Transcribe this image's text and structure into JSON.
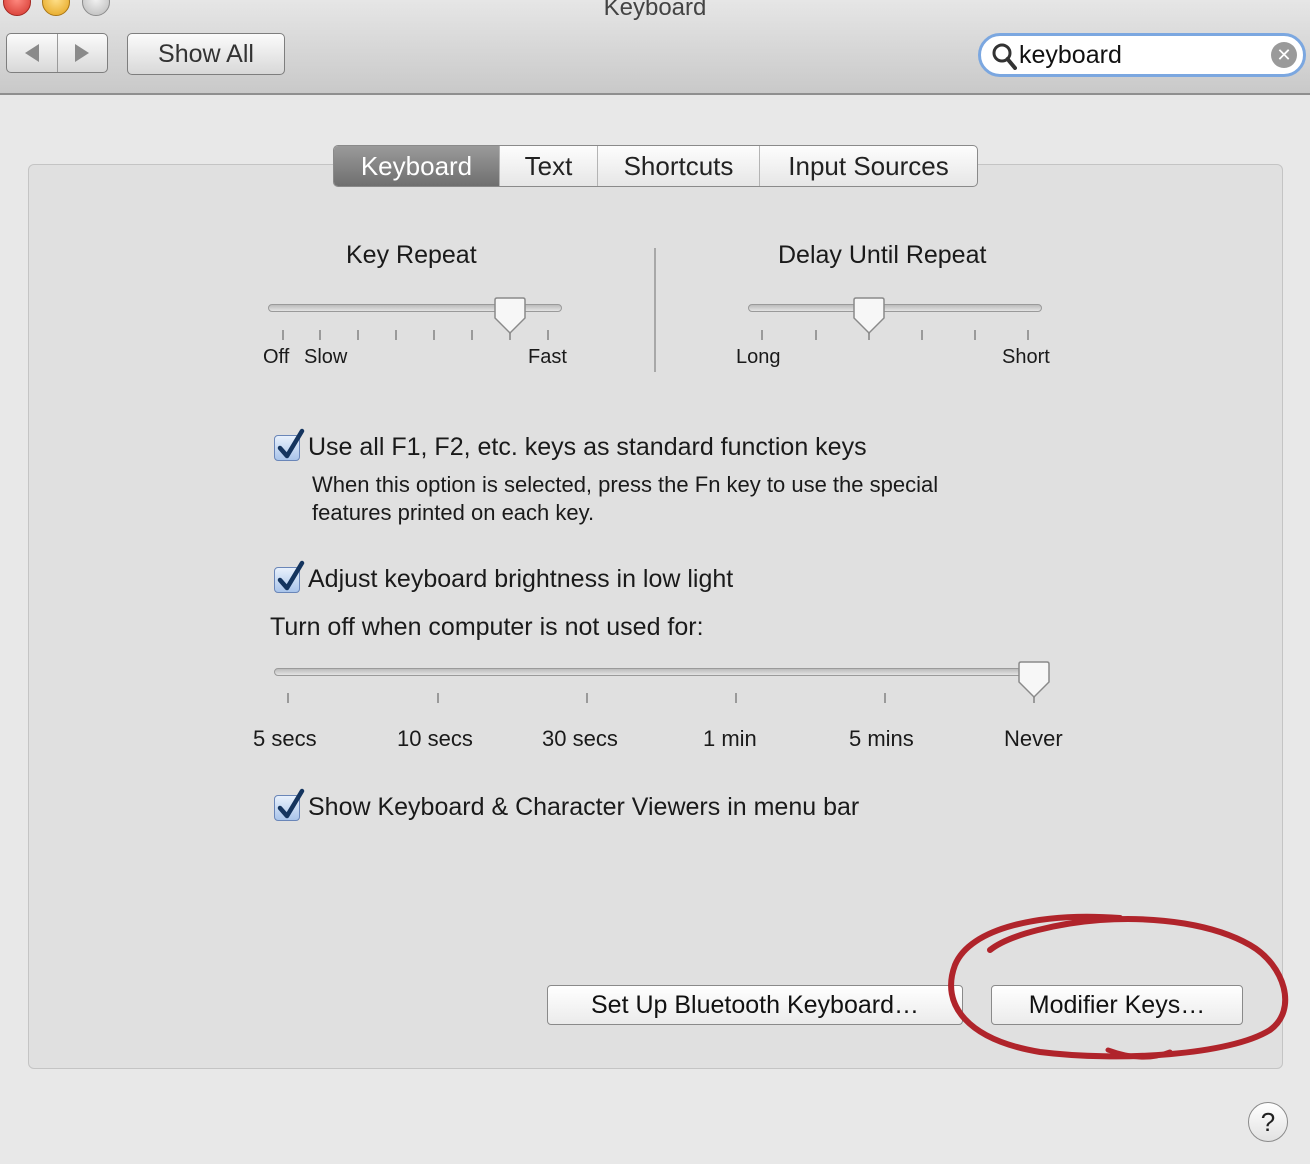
{
  "window": {
    "title": "Keyboard"
  },
  "toolbar": {
    "show_all_label": "Show All",
    "search": {
      "value": "keyboard",
      "placeholder": ""
    }
  },
  "tabs": [
    {
      "label": "Keyboard",
      "active": true
    },
    {
      "label": "Text",
      "active": false
    },
    {
      "label": "Shortcuts",
      "active": false
    },
    {
      "label": "Input Sources",
      "active": false
    }
  ],
  "key_repeat": {
    "title": "Key Repeat",
    "labels": {
      "off": "Off",
      "slow": "Slow",
      "fast": "Fast"
    },
    "value_fraction": 0.83
  },
  "delay_until_repeat": {
    "title": "Delay Until Repeat",
    "labels": {
      "long": "Long",
      "short": "Short"
    },
    "value_fraction": 0.4
  },
  "options": {
    "function_keys": {
      "label": "Use all F1, F2, etc. keys as standard function keys",
      "description_line1": "When this option is selected, press the Fn key to use the special",
      "description_line2": "features printed on each key.",
      "checked": true
    },
    "brightness": {
      "label": "Adjust keyboard brightness in low light",
      "checked": true
    },
    "turn_off_label": "Turn off when computer is not used for:",
    "turn_off_slider": {
      "ticks": [
        "5 secs",
        "10 secs",
        "30 secs",
        "1 min",
        "5 mins",
        "Never"
      ],
      "selected": "Never"
    },
    "viewers": {
      "label": "Show Keyboard & Character Viewers in menu bar",
      "checked": true
    }
  },
  "buttons": {
    "bluetooth": "Set Up Bluetooth Keyboard…",
    "modifier": "Modifier Keys…",
    "help": "?"
  },
  "colors": {
    "annotation": "#b0242b",
    "focus": "#7ba7e0"
  }
}
